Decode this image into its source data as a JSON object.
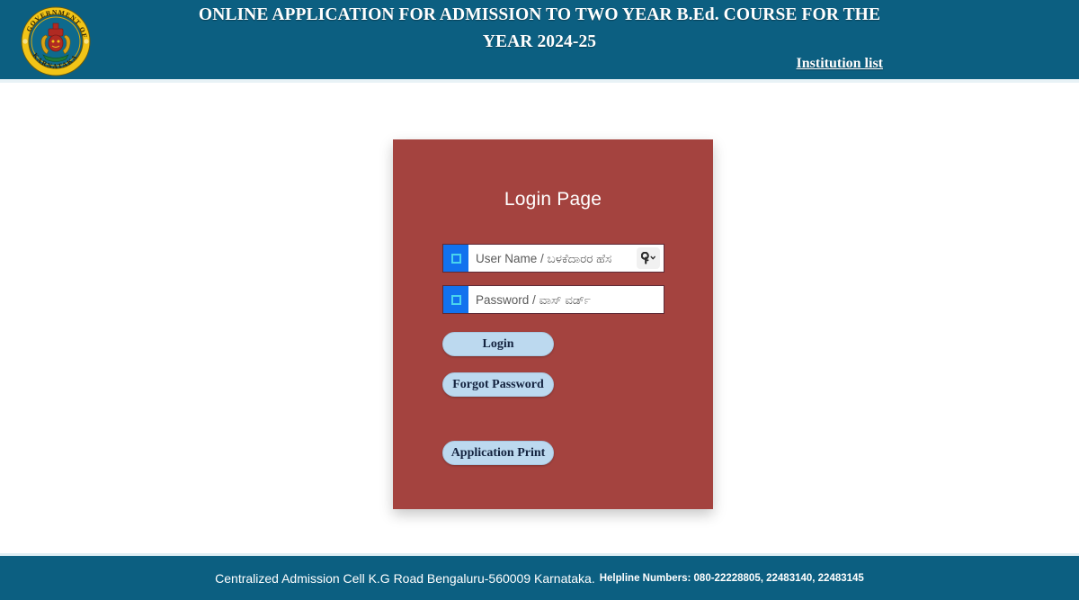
{
  "header": {
    "title_line1": "ONLINE APPLICATION FOR ADMISSION TO TWO YEAR B.Ed. COURSE FOR THE",
    "title_line2": "YEAR 2024-25",
    "institution_link": "Institution list",
    "emblem": {
      "top_text": "GOVERNMENT OF",
      "bottom_text": "KARNATAKA",
      "icon_name": "karnataka-state-emblem"
    },
    "background_color": "#0c5f81"
  },
  "login": {
    "title": "Login Page",
    "username": {
      "placeholder": "User Name / ಬಳಕೆದಾರರ ಹೆಸ",
      "value": "",
      "icon_name": "user-box-icon",
      "autofill_icon_name": "key-icon"
    },
    "password": {
      "placeholder": "Password / ವಾಸ್ ವರ್ಡ್",
      "value": "",
      "icon_name": "lock-box-icon"
    },
    "buttons": {
      "login": "Login",
      "forgot_password": "Forgot Password",
      "application_print": "Application Print"
    },
    "card_color": "#a4433f",
    "button_color": "#bcd9ef"
  },
  "footer": {
    "address": "Centralized Admission Cell K.G Road Bengaluru-560009 Karnataka.",
    "helpline": "Helpline Numbers: 080-22228805, 22483140, 22483145",
    "background_color": "#0c5f81"
  }
}
